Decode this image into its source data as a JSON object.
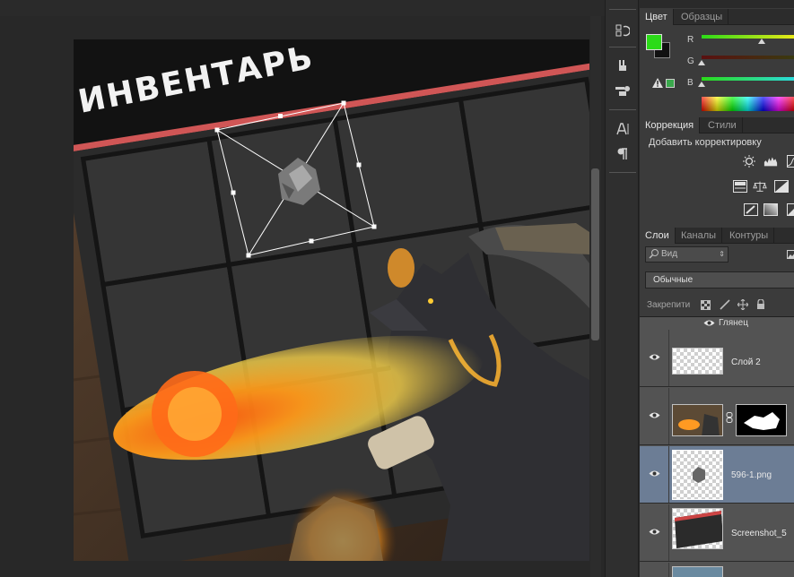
{
  "canvas": {
    "banner_title": "ИНВЕНТАРЬ"
  },
  "panel_collapse_glyph": "◂◂",
  "color_panel": {
    "tabs": [
      "Цвет",
      "Образцы"
    ],
    "active_tab": "Цвет",
    "foreground_color": "#2bdb18",
    "background_color": "#111111",
    "sliders": [
      {
        "label": "R",
        "value_fraction": 0.65
      },
      {
        "label": "G",
        "value_fraction": 0.0
      },
      {
        "label": "B",
        "value_fraction": 0.0
      }
    ]
  },
  "adjustments_panel": {
    "tabs": [
      "Коррекция",
      "Стили"
    ],
    "active_tab": "Коррекция",
    "title": "Добавить корректировку",
    "icons": [
      "brightness-icon",
      "levels-icon",
      "curves-icon",
      "exposure-icon",
      "vibrance-icon",
      "hue-saturation-icon",
      "color-balance-icon",
      "black-white-icon",
      "photo-filter-icon",
      "invert-icon",
      "posterize-icon",
      "threshold-icon"
    ]
  },
  "layers_panel": {
    "tabs": [
      "Слои",
      "Каналы",
      "Контуры"
    ],
    "active_tab": "Слои",
    "filter_kind": "Вид",
    "blend_mode": "Обычные",
    "lock_label": "Закрепити",
    "effect_label": "Глянец",
    "layers": [
      {
        "name": "Слой 2",
        "selected": false
      },
      {
        "name": "",
        "selected": false,
        "has_mask": true
      },
      {
        "name": "596-1.png",
        "selected": true
      },
      {
        "name": "Screenshot_5",
        "selected": false
      }
    ]
  },
  "tools": [
    "history-icon",
    "brush-preset-icon",
    "clone-source-icon",
    "character-icon",
    "paragraph-icon"
  ],
  "accent": {
    "selection_blue": "#6c7d95",
    "banner_red": "#d05656"
  }
}
